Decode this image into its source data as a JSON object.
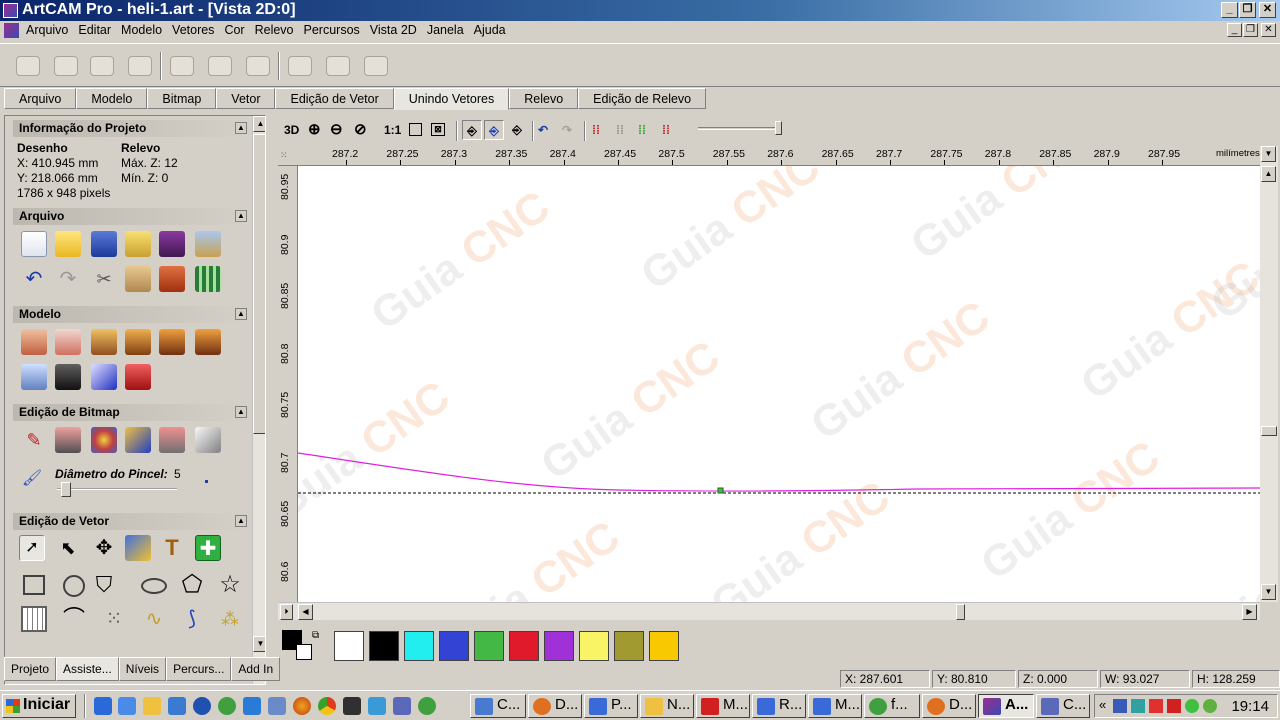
{
  "window": {
    "title": "ArtCAM Pro - heli-1.art - [Vista 2D:0]"
  },
  "menu": [
    "Arquivo",
    "Editar",
    "Modelo",
    "Vetores",
    "Cor",
    "Relevo",
    "Percursos",
    "Vista 2D",
    "Janela",
    "Ajuda"
  ],
  "tabs": [
    {
      "label": "Arquivo"
    },
    {
      "label": "Modelo"
    },
    {
      "label": "Bitmap"
    },
    {
      "label": "Vetor"
    },
    {
      "label": "Edição de Vetor"
    },
    {
      "label": "Unindo Vetores"
    },
    {
      "label": "Relevo"
    },
    {
      "label": "Edição de Relevo"
    }
  ],
  "active_tab": "Unindo Vetores",
  "panel": {
    "project_info": {
      "title": "Informação do Projeto",
      "desenho_label": "Desenho",
      "relevo_label": "Relevo",
      "x": "X: 410.945 mm",
      "y": "Y: 218.066 mm",
      "pixels": "1786 x 948 pixels",
      "max_z": "Máx. Z: 12",
      "min_z": "Mín. Z: 0"
    },
    "arquivo_title": "Arquivo",
    "modelo_title": "Modelo",
    "bitmap_title": "Edição de Bitmap",
    "brush_label": "Diâmetro do Pincel:",
    "brush_value": "5",
    "vetor_title": "Edição de Vetor"
  },
  "panel_tabs": [
    "Projeto",
    "Assiste...",
    "Níveis",
    "Percurs...",
    "Add In"
  ],
  "view_toolbar": {
    "view3d": "3D",
    "zoom_1to1": "1:1"
  },
  "ruler": {
    "x_labels": [
      "287.2",
      "287.25",
      "287.3",
      "287.35",
      "287.4",
      "287.45",
      "287.5",
      "287.55",
      "287.6",
      "287.65",
      "287.7",
      "287.75",
      "287.8",
      "287.85",
      "287.9",
      "287.95"
    ],
    "unit": "milímetres",
    "y_labels": [
      "80.95",
      "80.9",
      "80.85",
      "80.8",
      "80.75",
      "80.7",
      "80.65",
      "80.6"
    ]
  },
  "palette": {
    "colors": [
      "#ffffff",
      "#000000",
      "#22eef0",
      "#3344d4",
      "#44b844",
      "#e01a2a",
      "#a030d8",
      "#f8f466",
      "#a09a30",
      "#f8c800"
    ]
  },
  "status": {
    "x": "X: 287.601",
    "y": "Y: 80.810",
    "z": "Z: 0.000",
    "w": "W: 93.027",
    "h": "H: 128.259"
  },
  "taskbar": {
    "start": "Iniciar",
    "items": [
      "C...",
      "D...",
      "P...",
      "N...",
      "M...",
      "R...",
      "M...",
      "f...",
      "D...",
      "A...",
      "C..."
    ],
    "clock": "19:14"
  },
  "watermark": {
    "guia": "Guia",
    "cnc": "CNC"
  }
}
